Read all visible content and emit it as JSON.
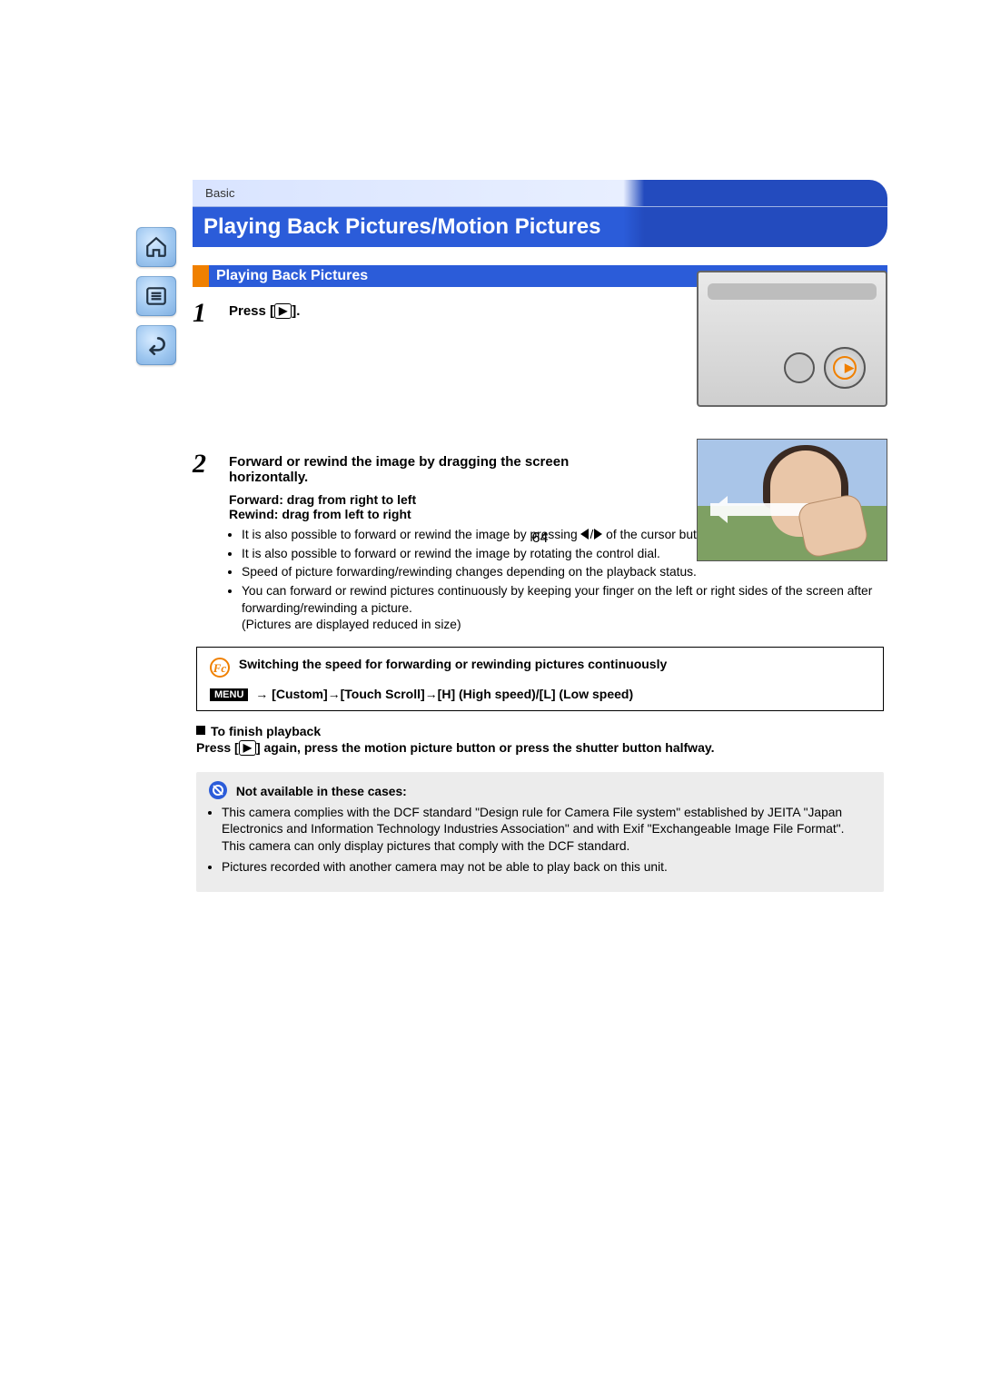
{
  "breadcrumb": "Basic",
  "title": "Playing Back Pictures/Motion Pictures",
  "subtitle": "Playing Back Pictures",
  "step1": {
    "num": "1",
    "label_pre": "Press [",
    "label_post": "]."
  },
  "step2": {
    "num": "2",
    "title": "Forward or rewind the image by dragging the screen horizontally.",
    "fwd": "Forward: drag from right to left",
    "rew": "Rewind: drag from left to right",
    "note1a": "It is also possible to forward or rewind the image by pressing ",
    "note1b": " of the cursor button.",
    "note2": "It is also possible to forward or rewind the image by rotating the control dial.",
    "note3": "Speed of picture forwarding/rewinding changes depending on the playback status.",
    "note4": "You can forward or rewind pictures continuously by keeping your finger on the left or right sides of the screen after forwarding/rewinding a picture.",
    "note4b": "(Pictures are displayed reduced in size)"
  },
  "callout": {
    "fc": "Fc",
    "heading": "Switching the speed for forwarding or rewinding pictures continuously",
    "menu": "MENU",
    "path": " →  [Custom]→[Touch Scroll]→[H] (High speed)/[L] (Low speed)"
  },
  "finish": {
    "heading": "To finish playback",
    "body_pre": "Press [",
    "body_post": "] again, press the motion picture button or press the shutter button halfway."
  },
  "notavail": {
    "heading": "Not available in these cases:",
    "n1": "This camera complies with the DCF standard \"Design rule for Camera File system\" established by JEITA \"Japan Electronics and Information Technology Industries Association\" and with Exif \"Exchangeable Image File Format\". This camera can only display pictures that comply with the DCF standard.",
    "n2": "Pictures recorded with another camera may not be able to play back on this unit."
  },
  "page": "64",
  "icons": {
    "play": "▶"
  }
}
